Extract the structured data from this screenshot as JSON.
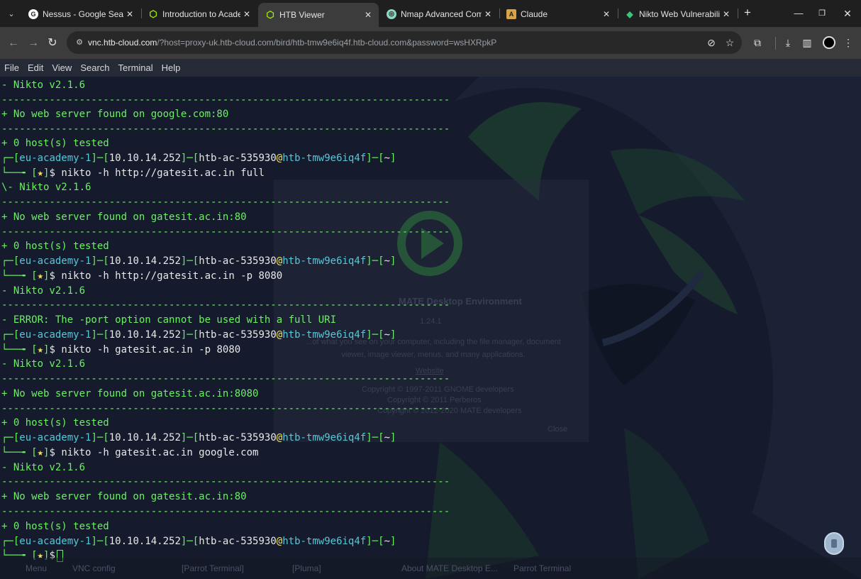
{
  "browser": {
    "tabs": [
      {
        "title": "Nessus - Google Search",
        "icon": "google-icon",
        "icon_color": "#ffffff"
      },
      {
        "title": "Introduction to Academy",
        "icon": "htb-cube-icon",
        "icon_color": "#9fef00"
      },
      {
        "title": "HTB Viewer",
        "icon": "htb-cube-icon",
        "icon_color": "#9fef00",
        "active": true
      },
      {
        "title": "Nmap Advanced Comman",
        "icon": "chatgpt-icon",
        "icon_color": "#8fd6c3"
      },
      {
        "title": "Claude",
        "icon": "anthropic-icon",
        "icon_color": "#d9a441"
      },
      {
        "title": "Nikto Web Vulnerability Sc",
        "icon": "nikto-icon",
        "icon_color": "#3cc47c"
      }
    ],
    "url_host": "vnc.htb-cloud.com",
    "url_rest": "/?host=proxy-uk.htb-cloud.com/bird/htb-tmw9e6iq4f.htb-cloud.com&password=wsHXRpkP"
  },
  "terminal_menu": [
    "File",
    "Edit",
    "View",
    "Search",
    "Terminal",
    "Help"
  ],
  "prompt": {
    "user_host": "eu-academy-1",
    "ip": "10.10.14.252",
    "user": "htb-ac-535930",
    "machine": "htb-tmw9e6iq4f",
    "dir": "~",
    "star": "★"
  },
  "terminal": {
    "dash_line": "---------------------------------------------------------------------------",
    "lines": {
      "l0": "- Nikto v2.1.6",
      "l2": "+ No web server found on google.com:80",
      "l4": "+ 0 host(s) tested",
      "cmd1": "nikto -h http://gatesit.ac.in full",
      "l7": "\\- Nikto v2.1.6",
      "l9": "+ No web server found on gatesit.ac.in:80",
      "l11": "+ 0 host(s) tested",
      "cmd2": "nikto -h http://gatesit.ac.in -p 8080",
      "l14": "- Nikto v2.1.6",
      "l16": "- ERROR: The -port option cannot be used with a full URI",
      "cmd3": "nikto -h gatesit.ac.in -p 8080",
      "l19": "- Nikto v2.1.6",
      "l21": "+ No web server found on gatesit.ac.in:8080",
      "l23": "+ 0 host(s) tested",
      "cmd4": "nikto -h gatesit.ac.in google.com",
      "l26": "- Nikto v2.1.6",
      "l28": "+ No web server found on gatesit.ac.in:80",
      "l30": "+ 0 host(s) tested"
    }
  },
  "background": {
    "about_title": "MATE Desktop Environment",
    "about_version": "1.24.1",
    "about_desc": "...of what you see on your computer, including the file manager, document viewer, image viewer, menus, and many applications.",
    "about_link": "Website",
    "copyright1": "Copyright © 1997-2011 GNOME developers",
    "copyright2": "Copyright © 2011 Perberos",
    "copyright3": "Copyright © 2012-2020 MATE developers",
    "close": "Close"
  },
  "taskbar": {
    "items": [
      "Menu",
      "VNC config",
      "[Parrot Terminal]",
      "[Pluma]",
      "About MATE Desktop E...",
      "Parrot Terminal"
    ]
  }
}
